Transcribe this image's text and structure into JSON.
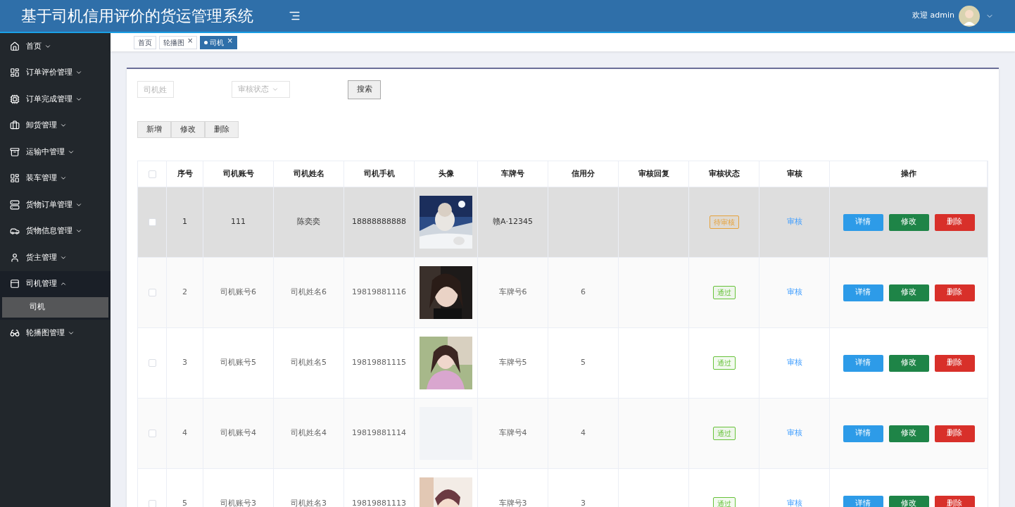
{
  "header": {
    "title": "基于司机信用评价的货运管理系统",
    "welcome": "欢迎 admin"
  },
  "sidebar": {
    "items": [
      {
        "label": "首页",
        "expanded": false
      },
      {
        "label": "订单评价管理",
        "expanded": false
      },
      {
        "label": "订单完成管理",
        "expanded": false
      },
      {
        "label": "卸货管理",
        "expanded": false
      },
      {
        "label": "运输中管理",
        "expanded": false
      },
      {
        "label": "装车管理",
        "expanded": false
      },
      {
        "label": "货物订单管理",
        "expanded": false
      },
      {
        "label": "货物信息管理",
        "expanded": false
      },
      {
        "label": "货主管理",
        "expanded": false
      },
      {
        "label": "司机管理",
        "expanded": true,
        "children": [
          {
            "label": "司机",
            "selected": true
          }
        ]
      },
      {
        "label": "轮播图管理",
        "expanded": false
      }
    ]
  },
  "tabs": [
    {
      "label": "首页",
      "selected": false
    },
    {
      "label": "轮播图",
      "selected": false,
      "close": "×"
    },
    {
      "label": "司机",
      "selected": true,
      "close": "×"
    }
  ],
  "filters": {
    "name_placeholder": "司机姓",
    "status_placeholder": "审核状态",
    "search": "搜索"
  },
  "actions": [
    "新增",
    "修改",
    "删除"
  ],
  "table": {
    "all_checked": false,
    "columns": [
      "序号",
      "司机账号",
      "司机姓名",
      "司机手机",
      "头像",
      "车牌号",
      "信用分",
      "审核回复",
      "审核状态",
      "审核",
      "操作"
    ],
    "rows": [
      {
        "index": "1",
        "account": "111",
        "name": "陈奕奕",
        "phone": "18888888888",
        "plate": "赣A·12345",
        "status": {
          "text": "待审核",
          "color": "#e6a23c"
        },
        "review": "审核",
        "buttons": [
          "详情",
          "修改",
          "删除"
        ],
        "highlighted": true,
        "checked": false
      },
      {
        "index": "2",
        "account": "司机账号6",
        "name": "司机姓名6",
        "phone": "19819881116",
        "plate": "车牌号6",
        "score": "6",
        "status": {
          "text": "通过",
          "color": "#67c23a"
        },
        "review": "审核",
        "buttons": [
          "详情",
          "修改",
          "删除"
        ],
        "highlighted": false,
        "checked": false
      },
      {
        "index": "3",
        "account": "司机账号5",
        "name": "司机姓名5",
        "phone": "19819881115",
        "plate": "车牌号5",
        "score": "5",
        "status": {
          "text": "通过",
          "color": "#67c23a"
        },
        "review": "审核",
        "buttons": [
          "详情",
          "修改",
          "删除"
        ],
        "highlighted": false,
        "checked": false
      },
      {
        "index": "4",
        "account": "司机账号4",
        "name": "司机姓名4",
        "phone": "19819881114",
        "plate": "车牌号4",
        "score": "4",
        "status": {
          "text": "通过",
          "color": "#67c23a"
        },
        "review": "审核",
        "buttons": [
          "详情",
          "修改",
          "删除"
        ],
        "highlighted": false,
        "checked": false
      },
      {
        "index": "5",
        "account": "司机账号3",
        "name": "司机姓名3",
        "phone": "19819881113",
        "plate": "车牌号3",
        "score": "3",
        "status": {
          "text": "通过",
          "color": "#67c23a"
        },
        "review": "审核",
        "buttons": [
          "详情",
          "修改",
          "删除"
        ],
        "highlighted": false,
        "checked": false
      }
    ]
  }
}
